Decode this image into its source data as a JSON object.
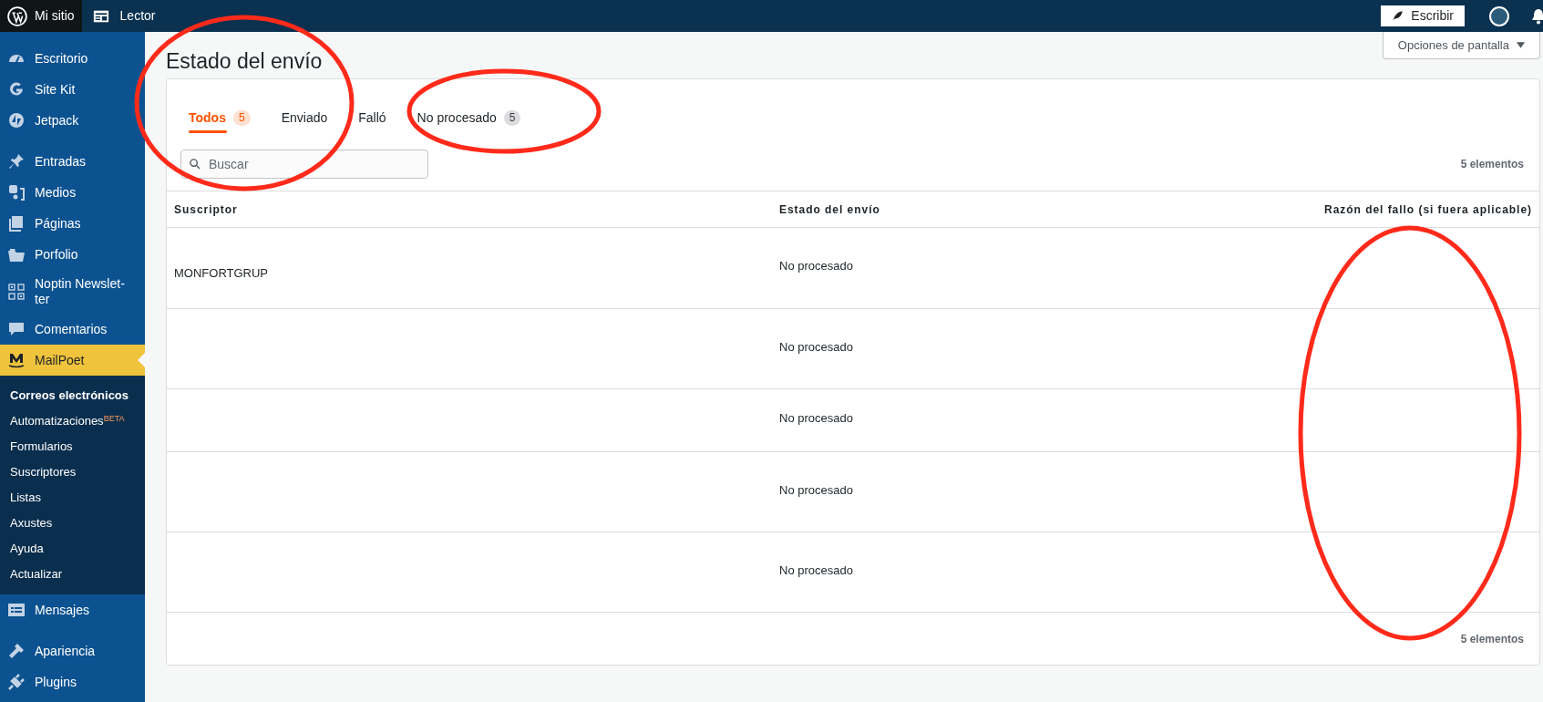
{
  "top_bar": {
    "site": "Mi sitio",
    "reader": "Lector",
    "write_button": "Escribir"
  },
  "sidebar": {
    "sections": [
      [
        {
          "label": "Escritorio",
          "selected": false
        },
        {
          "label": "Site Kit",
          "selected": false
        },
        {
          "label": "Jetpack",
          "selected": false
        }
      ],
      [
        {
          "label": "Entradas",
          "selected": false
        },
        {
          "label": "Medios",
          "selected": false
        },
        {
          "label": "Páginas",
          "selected": false
        },
        {
          "label": "Porfolio",
          "selected": false
        },
        {
          "label": "Noptin Newslet-ter",
          "selected": false
        },
        {
          "label": "Comentarios",
          "selected": false
        },
        {
          "label": "MailPoet",
          "selected": true,
          "children": [
            {
              "label": "Correos electrónicos",
              "selected": true
            },
            {
              "label": "Automatizaciones$^{BETA}$",
              "selected": false
            },
            {
              "label": "Formularios",
              "selected": false
            },
            {
              "label": "Suscriptores",
              "selected": false
            },
            {
              "label": "Listas",
              "selected": false
            },
            {
              "label": "Axustes",
              "selected": false
            },
            {
              "label": "Ayuda",
              "selected": false
            },
            {
              "label": "Actualizar",
              "selected": false
            }
          ]
        },
        {
          "label": "Mensajes",
          "selected": false
        }
      ],
      [
        {
          "label": "Apariencia",
          "selected": false
        },
        {
          "label": "Plugins",
          "selected": false
        }
      ]
    ]
  },
  "screen_options": "Opciones de pantalla",
  "page_title": "Estado del envío",
  "tabs": [
    {
      "label": "Todos",
      "count": "5",
      "selected": true
    },
    {
      "label": "Enviado",
      "selected": false
    },
    {
      "label": "Falló",
      "selected": false
    },
    {
      "label": "No procesado",
      "count": "5",
      "selected": false
    }
  ],
  "search": {
    "placeholder": "Buscar"
  },
  "item_count_top": "5 elementos",
  "table": {
    "columns": [
      "Suscriptor",
      "Estado del envío",
      "Razón del fallo (si fuera aplicable)"
    ],
    "rows": [
      {
        "subscriber": "MONFORTGRUP",
        "status": "No procesado"
      },
      {
        "status": "No procesado"
      },
      {
        "status": "No procesado"
      },
      {
        "status": "No procesado"
      },
      {
        "status": "No procesado"
      }
    ]
  },
  "item_count_bottom": "5 elementos"
}
